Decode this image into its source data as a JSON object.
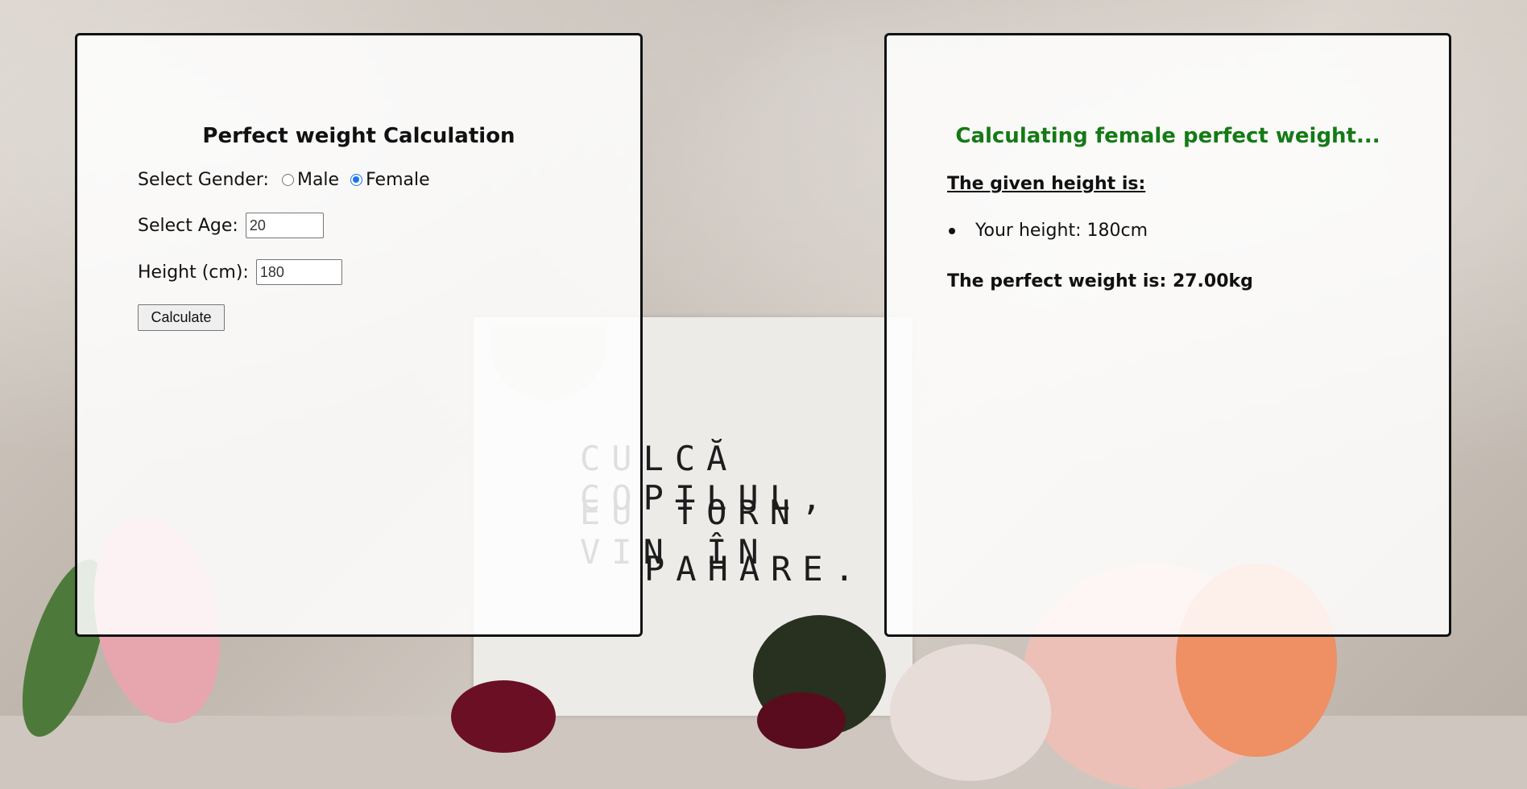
{
  "background": {
    "photo_text": [
      "CULCĂ COPILUL,",
      "EU TORN VIN ÎN",
      "PAHARE."
    ]
  },
  "form": {
    "title": "Perfect weight Calculation",
    "gender_label": "Select Gender:",
    "gender_options": [
      {
        "label": "Male",
        "checked": false
      },
      {
        "label": "Female",
        "checked": true
      }
    ],
    "age_label": "Select Age:",
    "age_value": "20",
    "height_label": "Height (cm):",
    "height_value": "180",
    "calculate_label": "Calculate"
  },
  "result": {
    "title": "Calculating female perfect weight...",
    "title_color": "#157a15",
    "given_height_heading": "The given height is:",
    "height_item": "Your height: 180cm",
    "perfect_weight": "The perfect weight is: 27.00kg"
  },
  "colors": {
    "accent_radio": "#1a73e8",
    "panel_border": "#111111"
  }
}
